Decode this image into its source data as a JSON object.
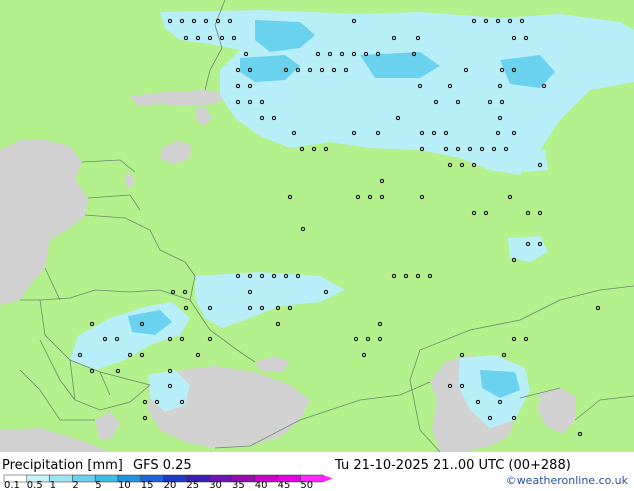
{
  "header": {
    "product": "Precipitation [mm]",
    "model": "GFS 0.25",
    "valid_time": "Tu 21-10-2025 21..00 UTC (00+288)",
    "credit": "©weatheronline.co.uk"
  },
  "legend": {
    "ticks": [
      "0.1",
      "0.5",
      "1",
      "2",
      "5",
      "10",
      "15",
      "20",
      "25",
      "30",
      "35",
      "40",
      "45",
      "50"
    ],
    "colors": [
      "#ffffff",
      "#c8f0f8",
      "#9ae4f4",
      "#6ad2ee",
      "#3cbde8",
      "#2094e0",
      "#1e64d6",
      "#1e3cc8",
      "#3c1eb4",
      "#6e14b4",
      "#9a0ab4",
      "#c800c8",
      "#e600e6",
      "#ff28ff"
    ]
  },
  "map": {
    "land_color": "#b4f08c",
    "sea_color": "#d2d2d2",
    "border_color": "#6a8a6a",
    "precip_light": "#b8eef8",
    "precip_mid": "#6ad2ee"
  }
}
